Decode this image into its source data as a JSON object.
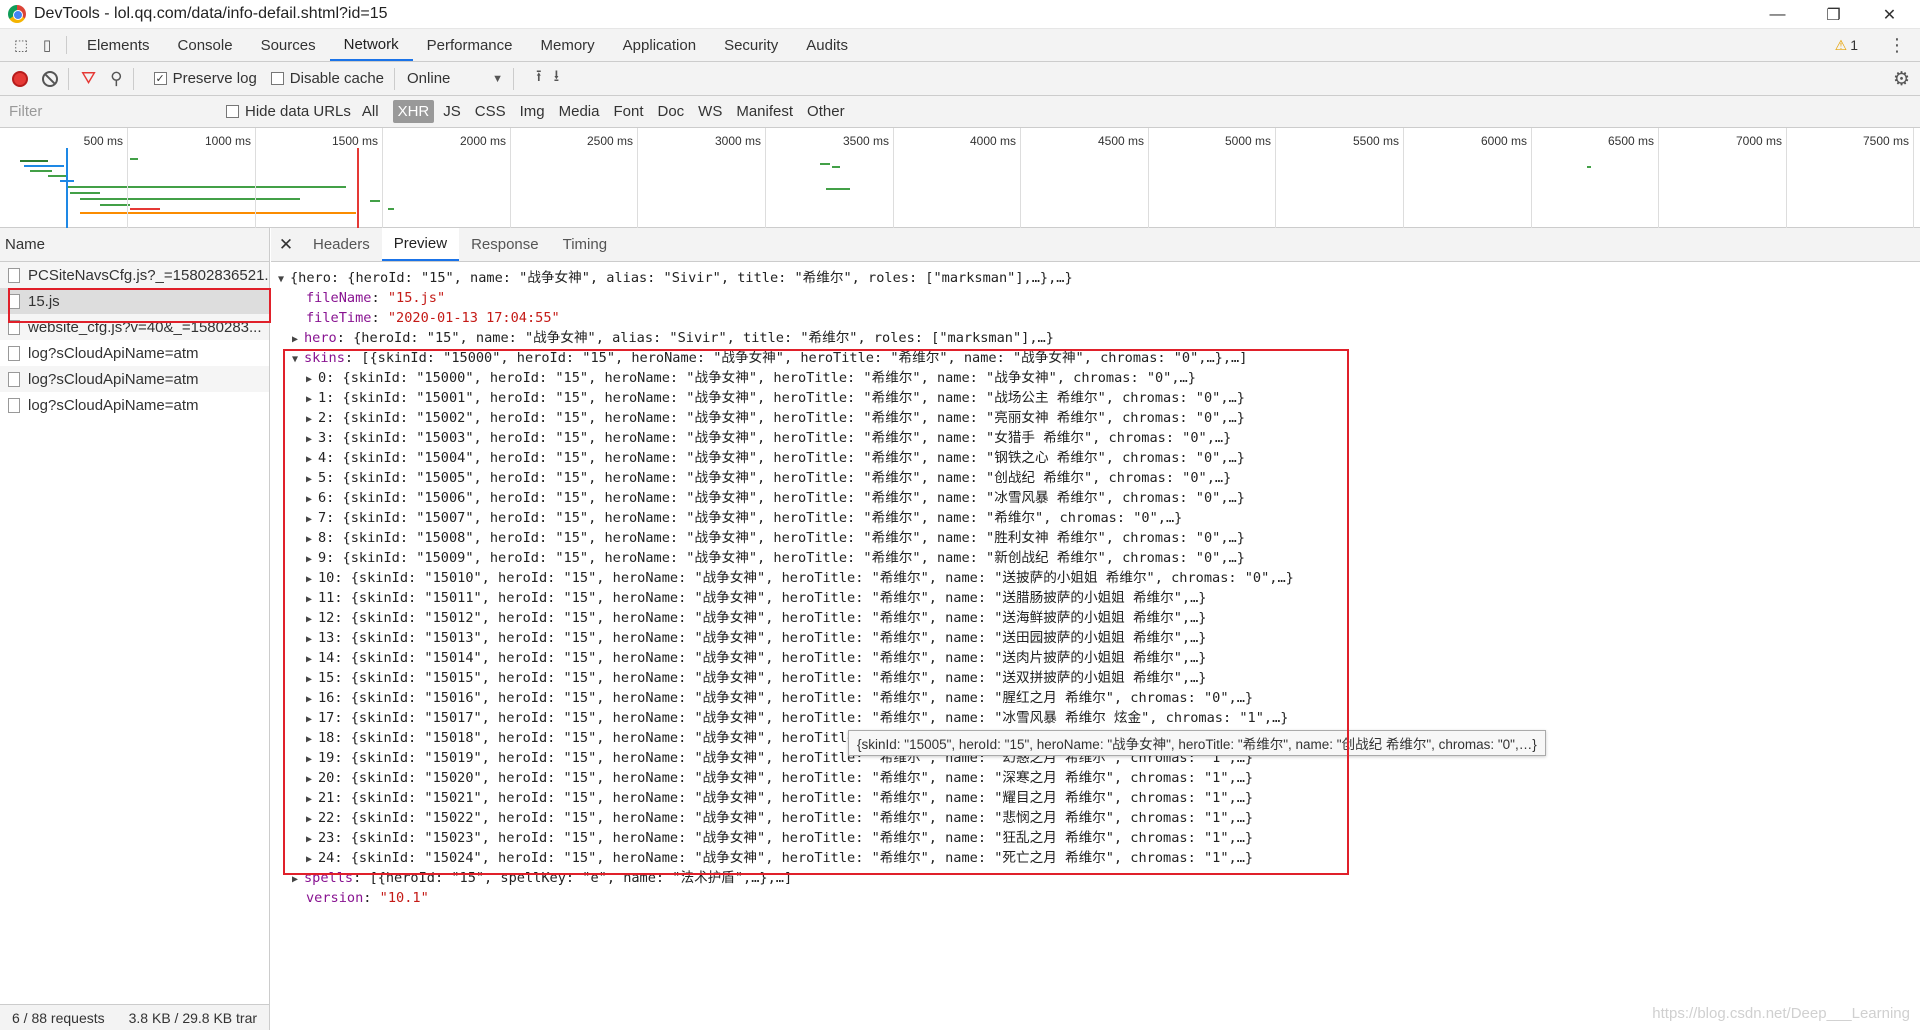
{
  "window": {
    "title": "DevTools - lol.qq.com/data/info-defail.shtml?id=15",
    "minimize": "—",
    "restore": "❐",
    "close": "✕"
  },
  "tabs": [
    {
      "label": "Elements"
    },
    {
      "label": "Console"
    },
    {
      "label": "Sources"
    },
    {
      "label": "Network"
    },
    {
      "label": "Performance"
    },
    {
      "label": "Memory"
    },
    {
      "label": "Application"
    },
    {
      "label": "Security"
    },
    {
      "label": "Audits"
    }
  ],
  "warnings": {
    "icon": "⚠",
    "count": "1"
  },
  "toolbar": {
    "preserve_log": "Preserve log",
    "disable_cache": "Disable cache",
    "throttle": "Online"
  },
  "filterbar": {
    "placeholder": "Filter",
    "hide_data_urls": "Hide data URLs",
    "types": [
      "All",
      "XHR",
      "JS",
      "CSS",
      "Img",
      "Media",
      "Font",
      "Doc",
      "WS",
      "Manifest",
      "Other"
    ],
    "active_type": "XHR"
  },
  "timeline": {
    "ticks": [
      "500 ms",
      "1000 ms",
      "1500 ms",
      "2000 ms",
      "2500 ms",
      "3000 ms",
      "3500 ms",
      "4000 ms",
      "4500 ms",
      "5000 ms",
      "5500 ms",
      "6000 ms",
      "6500 ms",
      "7000 ms",
      "7500 ms"
    ]
  },
  "requests": {
    "header": "Name",
    "items": [
      {
        "name": "PCSiteNavsCfg.js?_=15802836521..."
      },
      {
        "name": "15.js"
      },
      {
        "name": "website_cfg.js?v=40&_=1580283..."
      },
      {
        "name": "log?sCloudApiName=atm"
      },
      {
        "name": "log?sCloudApiName=atm"
      },
      {
        "name": "log?sCloudApiName=atm"
      }
    ],
    "status_requests": "6 / 88 requests",
    "status_size": "3.8 KB / 29.8 KB trar"
  },
  "detail_tabs": [
    {
      "label": "Headers"
    },
    {
      "label": "Preview"
    },
    {
      "label": "Response"
    },
    {
      "label": "Timing"
    }
  ],
  "preview": {
    "root": "{hero: {heroId: \"15\", name: \"战争女神\", alias: \"Sivir\", title: \"希维尔\", roles: [\"marksman\"],…},…}",
    "fileName_key": "fileName",
    "fileName_val": "\"15.js\"",
    "fileTime_key": "fileTime",
    "fileTime_val": "\"2020-01-13 17:04:55\"",
    "hero_key": "hero",
    "hero_val": "{heroId: \"15\", name: \"战争女神\", alias: \"Sivir\", title: \"希维尔\", roles: [\"marksman\"],…}",
    "skins_key": "skins",
    "skins_val": "[{skinId: \"15000\", heroId: \"15\", heroName: \"战争女神\", heroTitle: \"希维尔\", name: \"战争女神\", chromas: \"0\",…},…]",
    "skins": [
      "0: {skinId: \"15000\", heroId: \"15\", heroName: \"战争女神\", heroTitle: \"希维尔\", name: \"战争女神\", chromas: \"0\",…}",
      "1: {skinId: \"15001\", heroId: \"15\", heroName: \"战争女神\", heroTitle: \"希维尔\", name: \"战场公主 希维尔\", chromas: \"0\",…}",
      "2: {skinId: \"15002\", heroId: \"15\", heroName: \"战争女神\", heroTitle: \"希维尔\", name: \"亮丽女神 希维尔\", chromas: \"0\",…}",
      "3: {skinId: \"15003\", heroId: \"15\", heroName: \"战争女神\", heroTitle: \"希维尔\", name: \"女猎手 希维尔\", chromas: \"0\",…}",
      "4: {skinId: \"15004\", heroId: \"15\", heroName: \"战争女神\", heroTitle: \"希维尔\", name: \"钢铁之心 希维尔\", chromas: \"0\",…}",
      "5: {skinId: \"15005\", heroId: \"15\", heroName: \"战争女神\", heroTitle: \"希维尔\", name: \"创战纪 希维尔\", chromas: \"0\",…}",
      "6: {skinId: \"15006\", heroId: \"15\", heroName: \"战争女神\", heroTitle: \"希维尔\", name: \"冰雪风暴 希维尔\", chromas: \"0\",…}",
      "7: {skinId: \"15007\", heroId: \"15\", heroName: \"战争女神\", heroTitle: \"希维尔\", name: \"希维尔\", chromas: \"0\",…}",
      "8: {skinId: \"15008\", heroId: \"15\", heroName: \"战争女神\", heroTitle: \"希维尔\", name: \"胜利女神 希维尔\", chromas: \"0\",…}",
      "9: {skinId: \"15009\", heroId: \"15\", heroName: \"战争女神\", heroTitle: \"希维尔\", name: \"新创战纪 希维尔\", chromas: \"0\",…}",
      "10: {skinId: \"15010\", heroId: \"15\", heroName: \"战争女神\", heroTitle: \"希维尔\", name: \"送披萨的小姐姐 希维尔\", chromas: \"0\",…}",
      "11: {skinId: \"15011\", heroId: \"15\", heroName: \"战争女神\", heroTitle: \"希维尔\", name: \"送腊肠披萨的小姐姐 希维尔\",…}",
      "12: {skinId: \"15012\", heroId: \"15\", heroName: \"战争女神\", heroTitle: \"希维尔\", name: \"送海鲜披萨的小姐姐 希维尔\",…}",
      "13: {skinId: \"15013\", heroId: \"15\", heroName: \"战争女神\", heroTitle: \"希维尔\", name: \"送田园披萨的小姐姐 希维尔\",…}",
      "14: {skinId: \"15014\", heroId: \"15\", heroName: \"战争女神\", heroTitle: \"希维尔\", name: \"送肉片披萨的小姐姐 希维尔\",…}",
      "15: {skinId: \"15015\", heroId: \"15\", heroName: \"战争女神\", heroTitle: \"希维尔\", name: \"送双拼披萨的小姐姐 希维尔\",…}",
      "16: {skinId: \"15016\", heroId: \"15\", heroName: \"战争女神\", heroTitle: \"希维尔\", name: \"腥红之月 希维尔\", chromas: \"0\",…}",
      "17: {skinId: \"15017\", heroId: \"15\", heroName: \"战争女神\", heroTitle: \"希维尔\", name: \"冰雪风暴 希维尔 炫金\", chromas: \"1\",…}",
      "18: {skinId: \"15018\", heroId: \"15\", heroName: \"战争女神\", heroTitle: \"希维尔\", name: \"不祥之月 希维尔\", chromas: \"1\",…}",
      "19: {skinId: \"15019\", heroId: \"15\", heroName: \"战争女神\", heroTitle: \"希维尔\", name: \"幻惑之月 希维尔\", chromas: \"1\",…}",
      "20: {skinId: \"15020\", heroId: \"15\", heroName: \"战争女神\", heroTitle: \"希维尔\", name: \"深寒之月 希维尔\", chromas: \"1\",…}",
      "21: {skinId: \"15021\", heroId: \"15\", heroName: \"战争女神\", heroTitle: \"希维尔\", name: \"耀目之月 希维尔\", chromas: \"1\",…}",
      "22: {skinId: \"15022\", heroId: \"15\", heroName: \"战争女神\", heroTitle: \"希维尔\", name: \"悲悯之月 希维尔\", chromas: \"1\",…}",
      "23: {skinId: \"15023\", heroId: \"15\", heroName: \"战争女神\", heroTitle: \"希维尔\", name: \"狂乱之月 希维尔\", chromas: \"1\",…}",
      "24: {skinId: \"15024\", heroId: \"15\", heroName: \"战争女神\", heroTitle: \"希维尔\", name: \"死亡之月 希维尔\", chromas: \"1\",…}"
    ],
    "spells_key": "spells",
    "spells_val": "[{heroId: \"15\", spellKey: \"e\", name: \"法术护盾\",…},…]",
    "version_key": "version",
    "version_val": "\"10.1\""
  },
  "tooltip": "{skinId: \"15005\", heroId: \"15\", heroName: \"战争女神\", heroTitle: \"希维尔\", name: \"创战纪 希维尔\", chromas: \"0\",…}",
  "watermark": "https://blog.csdn.net/Deep___Learning",
  "colors": {
    "accent": "#1a73e8",
    "highlight_box": "#e0202a",
    "record": "#e53935"
  }
}
